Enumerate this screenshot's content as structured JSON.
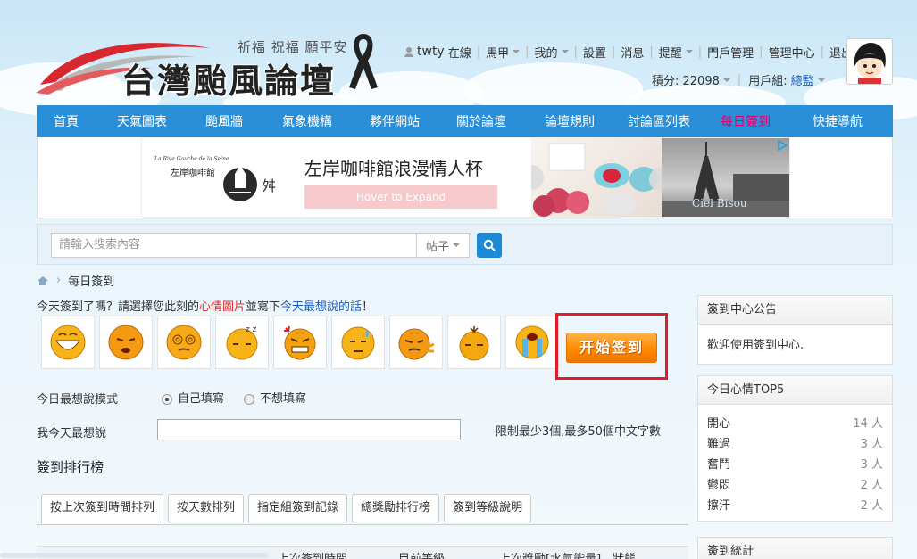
{
  "header": {
    "slogan": "祈福 祝福 願平安",
    "site_title": "台灣颱風論壇",
    "user": {
      "name": "twty",
      "status": "在線",
      "links": [
        "馬甲",
        "我的",
        "設置",
        "消息",
        "提醒",
        "門戶管理",
        "管理中心",
        "退出"
      ],
      "points_label": "積分: 22098",
      "group_label": "用戶組:",
      "group_value": "總監"
    }
  },
  "nav": {
    "items": [
      "首頁",
      "天氣圖表",
      "颱風牆",
      "氣象機構",
      "夥伴網站",
      "關於論壇",
      "論壇規則",
      "討論區列表",
      "每日簽到",
      "快捷導航"
    ],
    "active_color": "#e0006b"
  },
  "ad": {
    "logo_text": "左岸咖啡館",
    "logo_small": "La Rive Gauche de la Seine",
    "title": "左岸咖啡館浪漫情人杯",
    "hover_label": "Hover to Expand",
    "photo_text": "Ciel Bisou"
  },
  "search": {
    "placeholder": "請輸入搜索內容",
    "type": "帖子"
  },
  "breadcrumb": {
    "current": "每日簽到"
  },
  "signin": {
    "prompt_1": "今天簽到了嗎？請選擇您此刻的",
    "prompt_red": "心情圖片",
    "prompt_2": "並寫下",
    "prompt_blue": "今天最想說的話",
    "prompt_3": "！",
    "button_label": "开始签到",
    "mode_label": "今日最想說模式",
    "mode_options": [
      "自己填寫",
      "不想填寫"
    ],
    "say_label": "我今天最想說",
    "limit_text": "限制最少3個,最多50個中文字數"
  },
  "ranking": {
    "title": "簽到排行榜",
    "tabs": [
      "按上次簽到時間排列",
      "按天數排列",
      "指定組簽到記錄",
      "總獎勵排行榜",
      "簽到等級說明"
    ],
    "table_headers": [
      "上次簽到時間",
      "目前等級",
      "上次獎勵[水氣能量]",
      "狀態"
    ]
  },
  "sidebar": {
    "notice_title": "簽到中心公告",
    "notice_body": "歡迎使用簽到中心.",
    "top5_title": "今日心情TOP5",
    "top5": [
      {
        "mood": "開心",
        "count": "14 人"
      },
      {
        "mood": "難過",
        "count": "3 人"
      },
      {
        "mood": "奮鬥",
        "count": "3 人"
      },
      {
        "mood": "鬱悶",
        "count": "2 人"
      },
      {
        "mood": "擦汗",
        "count": "2 人"
      }
    ],
    "stats_title": "簽到統計"
  }
}
